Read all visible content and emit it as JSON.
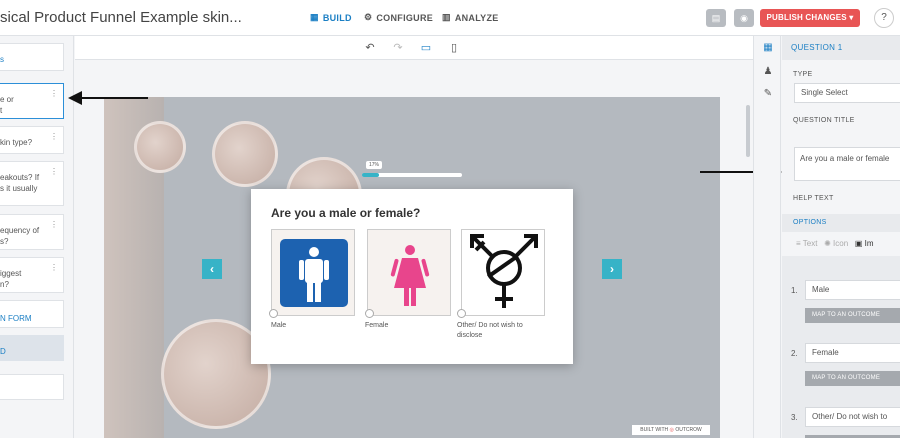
{
  "header": {
    "title": "sical Product Funnel Example skin...",
    "nav": [
      {
        "label": "BUILD",
        "icon": "grid-icon"
      },
      {
        "label": "CONFIGURE",
        "icon": "gear-icon"
      },
      {
        "label": "ANALYZE",
        "icon": "bar-chart-icon"
      }
    ],
    "publish_label": "PUBLISH CHANGES",
    "help_label": "?"
  },
  "sidebar": {
    "items": [
      {
        "label": "s"
      },
      {
        "label": "e or\nt"
      },
      {
        "label": "kin type?"
      },
      {
        "label": "eakouts? If\ns it usually"
      },
      {
        "label": "equency of\ns?"
      },
      {
        "label": "iggest\nn?"
      },
      {
        "label": "N FORM"
      },
      {
        "label": "D"
      }
    ]
  },
  "quiz": {
    "progress_label": "17%",
    "progress_fraction": 0.17,
    "question": "Are you a male or female?",
    "options": [
      {
        "label": "Male"
      },
      {
        "label": "Female"
      },
      {
        "label": "Other/ Do not wish to disclose"
      }
    ],
    "built_with": "BUILT WITH",
    "brand": "OUTCROW"
  },
  "panel": {
    "header": "QUESTION 1",
    "type_label": "TYPE",
    "type_value": "Single Select",
    "title_label": "QUESTION TITLE",
    "title_value": "Are you a male or female",
    "help_label": "HELP TEXT",
    "options_label": "OPTIONS",
    "tabs": [
      "Text",
      "Icon",
      "Im"
    ],
    "options": [
      {
        "num": "1.",
        "value": "Male"
      },
      {
        "num": "2.",
        "value": "Female"
      },
      {
        "num": "3.",
        "value": "Other/ Do not wish to"
      }
    ],
    "map_label": "MAP TO AN OUTCOME"
  },
  "colors": {
    "accent": "#1b7fc4",
    "publish": "#e85555",
    "teal": "#37b3c7"
  }
}
